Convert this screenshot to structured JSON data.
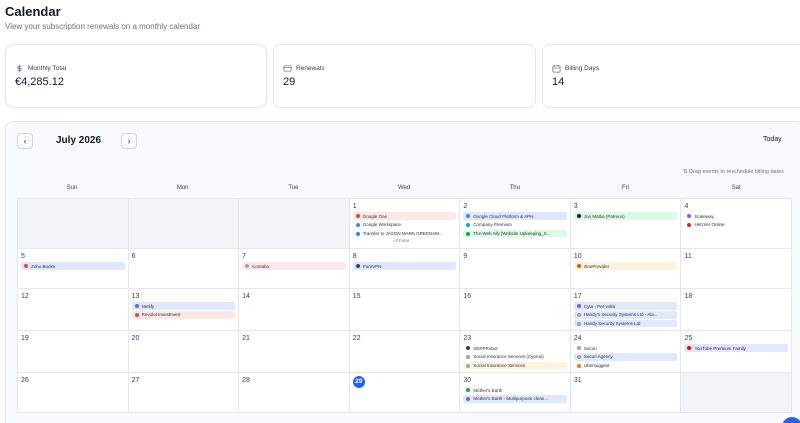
{
  "header": {
    "title": "Calendar",
    "subtitle": "View your subscription renewals on a monthly calendar"
  },
  "stats": [
    {
      "label": "Monthly Total",
      "value": "€4,285.12",
      "icon": "dollar-icon"
    },
    {
      "label": "Renewals",
      "value": "29",
      "icon": "card-icon"
    },
    {
      "label": "Billing Days",
      "value": "14",
      "icon": "calendar-icon"
    }
  ],
  "calendar": {
    "month": "July 2026",
    "prev": "‹",
    "next": "›",
    "today_label": "Today",
    "hint": "Drag events to reschedule billing dates",
    "weekdays": [
      "Sun",
      "Mon",
      "Tue",
      "Wed",
      "Thu",
      "Fri",
      "Sat"
    ],
    "today_day": "29",
    "more_label": "+2 more",
    "colors": {
      "red": "#ef4444",
      "blue": "#6366f1",
      "green": "#22c55e",
      "orange": "#f97316",
      "accent": "#2563eb"
    }
  },
  "weeks": [
    [
      {
        "day": "",
        "outside": true,
        "events": []
      },
      {
        "day": "",
        "outside": true,
        "events": []
      },
      {
        "day": "",
        "outside": true,
        "events": []
      },
      {
        "day": "1",
        "events": [
          {
            "name": "Google One",
            "bg": "red",
            "dot": "#ea4335"
          },
          {
            "name": "Google Workspace",
            "bg": "plain",
            "dot": "#4285f4"
          },
          {
            "name": "Transfer to JASON MARK GREENAW...",
            "bg": "plain",
            "dot": "#3b82f6"
          }
        ],
        "more": true
      },
      {
        "day": "2",
        "events": [
          {
            "name": "Google Cloud Platform & APIs",
            "bg": "blue",
            "dot": "#4285f4"
          },
          {
            "name": "Company Premium",
            "bg": "plain",
            "dot": "#0ea5e9"
          },
          {
            "name": "The Web Ally [Website Upkeeping_S...",
            "bg": "green",
            "dot": "#16a34a"
          }
        ]
      },
      {
        "day": "3",
        "events": [
          {
            "name": "Jon Mattia (Patreon)",
            "bg": "green",
            "dot": "#111827"
          }
        ]
      },
      {
        "day": "4",
        "events": [
          {
            "name": "Scaleway",
            "bg": "plain",
            "dot": "#8b5cf6"
          },
          {
            "name": "Hetzner Online",
            "bg": "plain",
            "dot": "#dc2626"
          }
        ]
      }
    ],
    [
      {
        "day": "5",
        "events": [
          {
            "name": "Zoho Books",
            "bg": "blue",
            "dot": "#ef4444"
          }
        ]
      },
      {
        "day": "6",
        "events": []
      },
      {
        "day": "7",
        "events": [
          {
            "name": "Contabo",
            "bg": "red",
            "dot": "#9ca3af"
          }
        ]
      },
      {
        "day": "8",
        "events": [
          {
            "name": "PureVPN",
            "bg": "blue",
            "dot": "#1e40af"
          }
        ]
      },
      {
        "day": "9",
        "events": []
      },
      {
        "day": "10",
        "events": [
          {
            "name": "OneProvider",
            "bg": "orange",
            "dot": "#ea580c"
          }
        ]
      },
      {
        "day": "11",
        "events": []
      }
    ],
    [
      {
        "day": "12",
        "events": []
      },
      {
        "day": "13",
        "events": [
          {
            "name": "Netlify",
            "bg": "blue",
            "dot": "#6366f1"
          },
          {
            "name": "Revolut Investment",
            "bg": "red",
            "dot": "#ef4444"
          }
        ]
      },
      {
        "day": "14",
        "events": []
      },
      {
        "day": "15",
        "events": []
      },
      {
        "day": "16",
        "events": []
      },
      {
        "day": "17",
        "events": [
          {
            "name": "Cyta - Per-volta",
            "bg": "blue",
            "dot": "#6366f1"
          },
          {
            "name": "Handy's Security Systems Ltd - Ala...",
            "bg": "blue",
            "dot": "#9ca3af"
          },
          {
            "name": "Handy Security Systems Ltd",
            "bg": "blue",
            "dot": "#9ca3af"
          }
        ]
      },
      {
        "day": "18",
        "events": []
      }
    ],
    [
      {
        "day": "19",
        "events": []
      },
      {
        "day": "20",
        "events": []
      },
      {
        "day": "21",
        "events": []
      },
      {
        "day": "22",
        "events": []
      },
      {
        "day": "23",
        "events": [
          {
            "name": "SERPRobot",
            "bg": "plain",
            "dot": "#1e3a8a"
          },
          {
            "name": "Social Insurance Services (Cyprus)",
            "bg": "plain",
            "dot": "#9ca3af"
          },
          {
            "name": "Social Insurance Services",
            "bg": "orange",
            "dot": "#9ca3af"
          }
        ]
      },
      {
        "day": "24",
        "events": [
          {
            "name": "Sucuri",
            "bg": "plain",
            "dot": "#9ca3af"
          },
          {
            "name": "Sucuri Agency",
            "bg": "blue",
            "dot": "#9ca3af"
          },
          {
            "name": "Ubersuggest",
            "bg": "plain",
            "dot": "#f97316"
          }
        ]
      },
      {
        "day": "25",
        "events": [
          {
            "name": "YouTube Premium Family",
            "bg": "blue",
            "dot": "#ff0000"
          }
        ]
      }
    ],
    [
      {
        "day": "26",
        "events": []
      },
      {
        "day": "27",
        "events": []
      },
      {
        "day": "28",
        "events": []
      },
      {
        "day": "29",
        "today": true,
        "events": []
      },
      {
        "day": "30",
        "events": [
          {
            "name": "Mother's Earth",
            "bg": "plain",
            "dot": "#16a34a"
          },
          {
            "name": "Mother's Earth - Multipurpose clean...",
            "bg": "blue",
            "dot": "#6366f1"
          }
        ]
      },
      {
        "day": "31",
        "events": []
      },
      {
        "day": "",
        "outside": true,
        "events": []
      }
    ]
  ]
}
